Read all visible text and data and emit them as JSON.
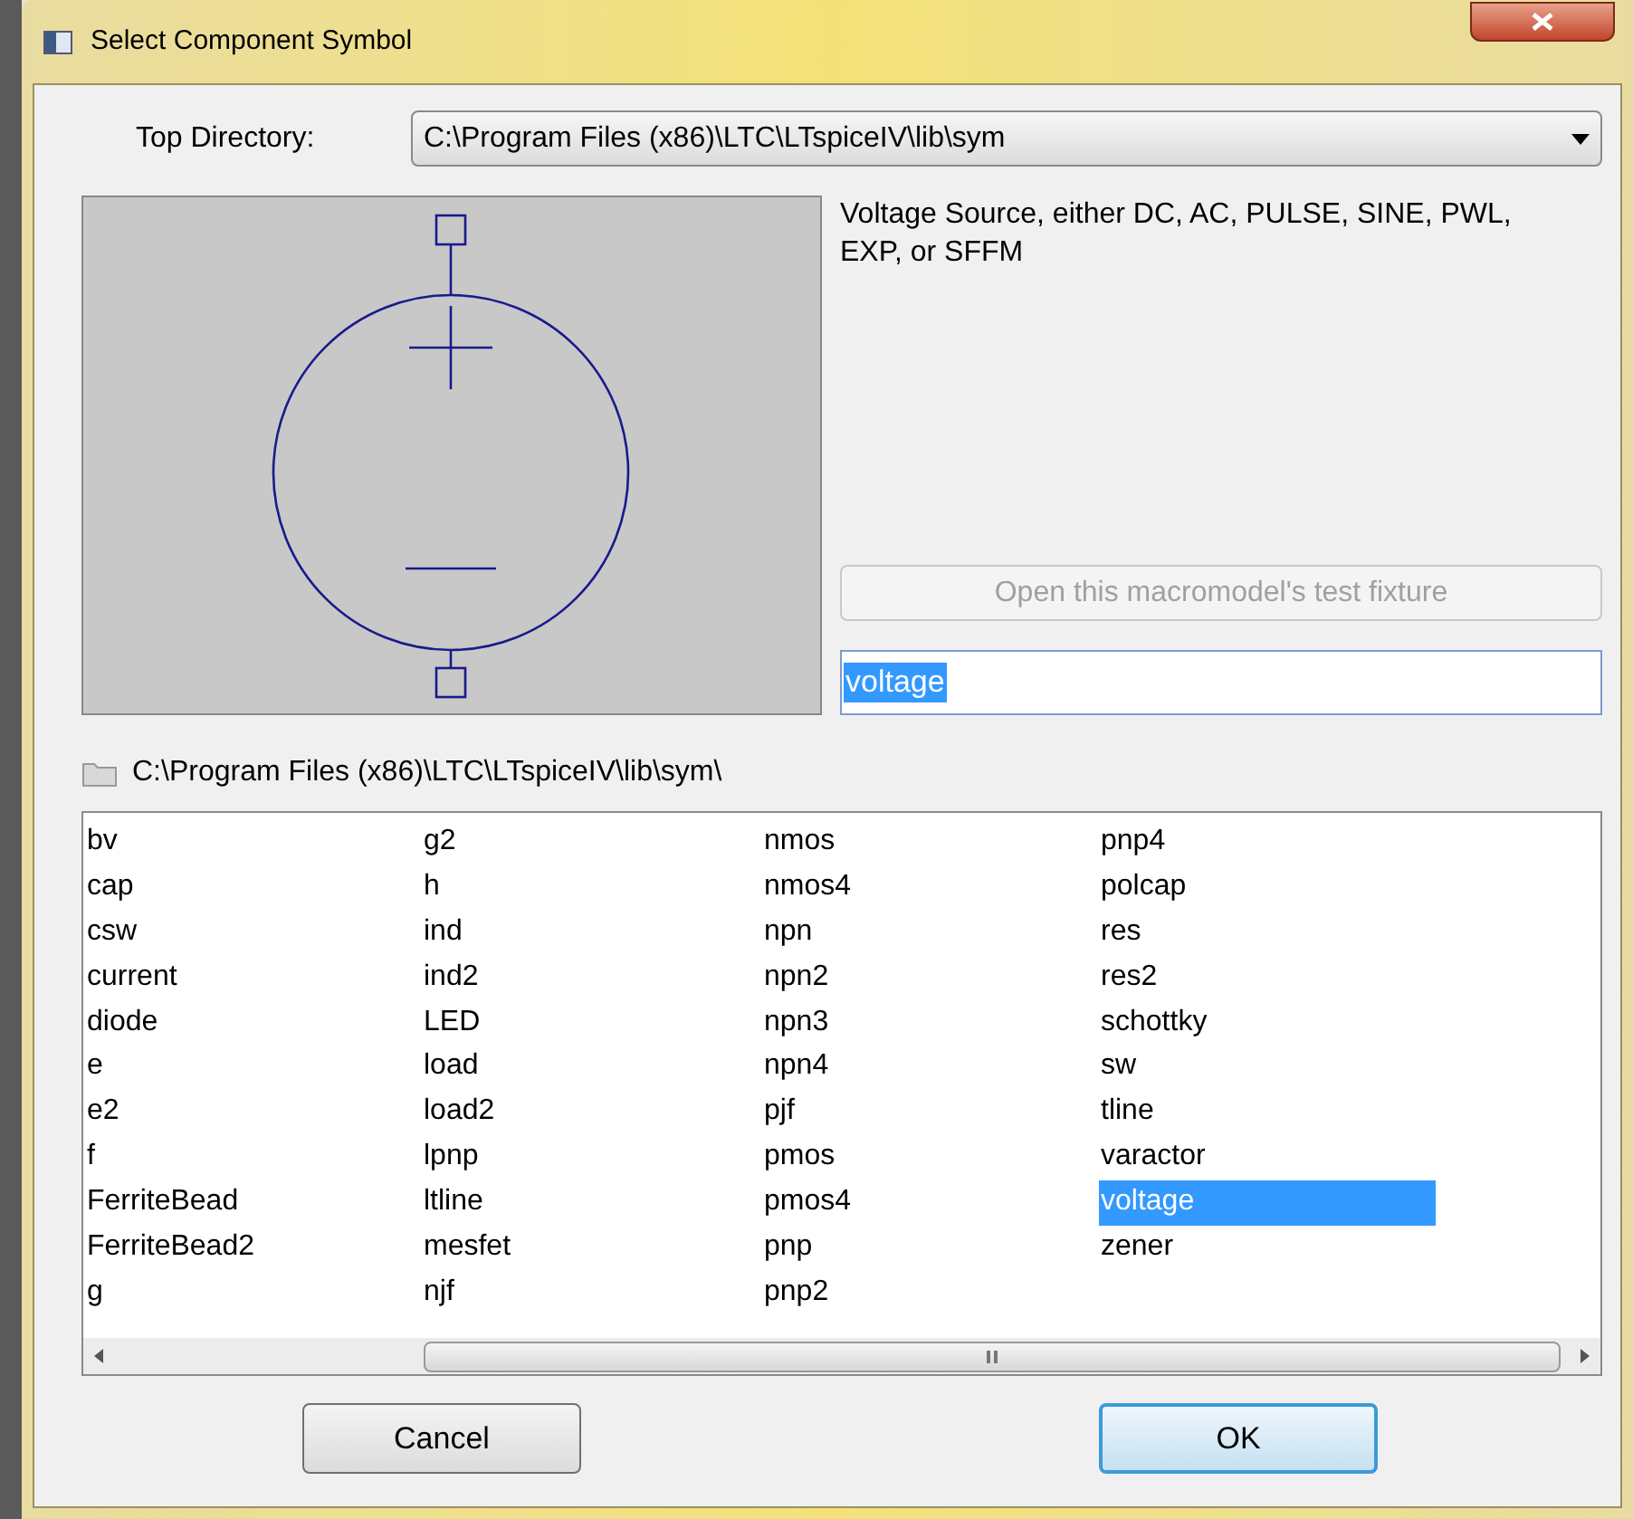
{
  "window": {
    "title": "Select Component Symbol"
  },
  "top_directory": {
    "label": "Top Directory:",
    "value": "C:\\Program Files (x86)\\LTC\\LTspiceIV\\lib\\sym"
  },
  "description": "Voltage Source, either DC, AC, PULSE, SINE, PWL, EXP, or SFFM",
  "test_fixture_button": {
    "label": "Open this macromodel's test fixture",
    "disabled": true
  },
  "name_field": {
    "value": "voltage",
    "text_selected": true
  },
  "folder_path": "C:\\Program Files (x86)\\LTC\\LTspiceIV\\lib\\sym\\",
  "symbols": [
    {
      "label": "bv",
      "selected": false
    },
    {
      "label": "cap",
      "selected": false
    },
    {
      "label": "csw",
      "selected": false
    },
    {
      "label": "current",
      "selected": false
    },
    {
      "label": "diode",
      "selected": false
    },
    {
      "label": "e",
      "selected": false
    },
    {
      "label": "e2",
      "selected": false
    },
    {
      "label": "f",
      "selected": false
    },
    {
      "label": "FerriteBead",
      "selected": false
    },
    {
      "label": "FerriteBead2",
      "selected": false
    },
    {
      "label": "g",
      "selected": false
    },
    {
      "label": "g2",
      "selected": false
    },
    {
      "label": "h",
      "selected": false
    },
    {
      "label": "ind",
      "selected": false
    },
    {
      "label": "ind2",
      "selected": false
    },
    {
      "label": "LED",
      "selected": false
    },
    {
      "label": "load",
      "selected": false
    },
    {
      "label": "load2",
      "selected": false
    },
    {
      "label": "lpnp",
      "selected": false
    },
    {
      "label": "ltline",
      "selected": false
    },
    {
      "label": "mesfet",
      "selected": false
    },
    {
      "label": "njf",
      "selected": false
    },
    {
      "label": "nmos",
      "selected": false
    },
    {
      "label": "nmos4",
      "selected": false
    },
    {
      "label": "npn",
      "selected": false
    },
    {
      "label": "npn2",
      "selected": false
    },
    {
      "label": "npn3",
      "selected": false
    },
    {
      "label": "npn4",
      "selected": false
    },
    {
      "label": "pjf",
      "selected": false
    },
    {
      "label": "pmos",
      "selected": false
    },
    {
      "label": "pmos4",
      "selected": false
    },
    {
      "label": "pnp",
      "selected": false
    },
    {
      "label": "pnp2",
      "selected": false
    },
    {
      "label": "pnp4",
      "selected": false
    },
    {
      "label": "polcap",
      "selected": false
    },
    {
      "label": "res",
      "selected": false
    },
    {
      "label": "res2",
      "selected": false
    },
    {
      "label": "schottky",
      "selected": false
    },
    {
      "label": "sw",
      "selected": false
    },
    {
      "label": "tline",
      "selected": false
    },
    {
      "label": "varactor",
      "selected": false
    },
    {
      "label": "voltage",
      "selected": true
    },
    {
      "label": "zener",
      "selected": false
    }
  ],
  "buttons": [
    {
      "label": "Cancel",
      "default": false
    },
    {
      "label": "OK",
      "default": true
    }
  ]
}
